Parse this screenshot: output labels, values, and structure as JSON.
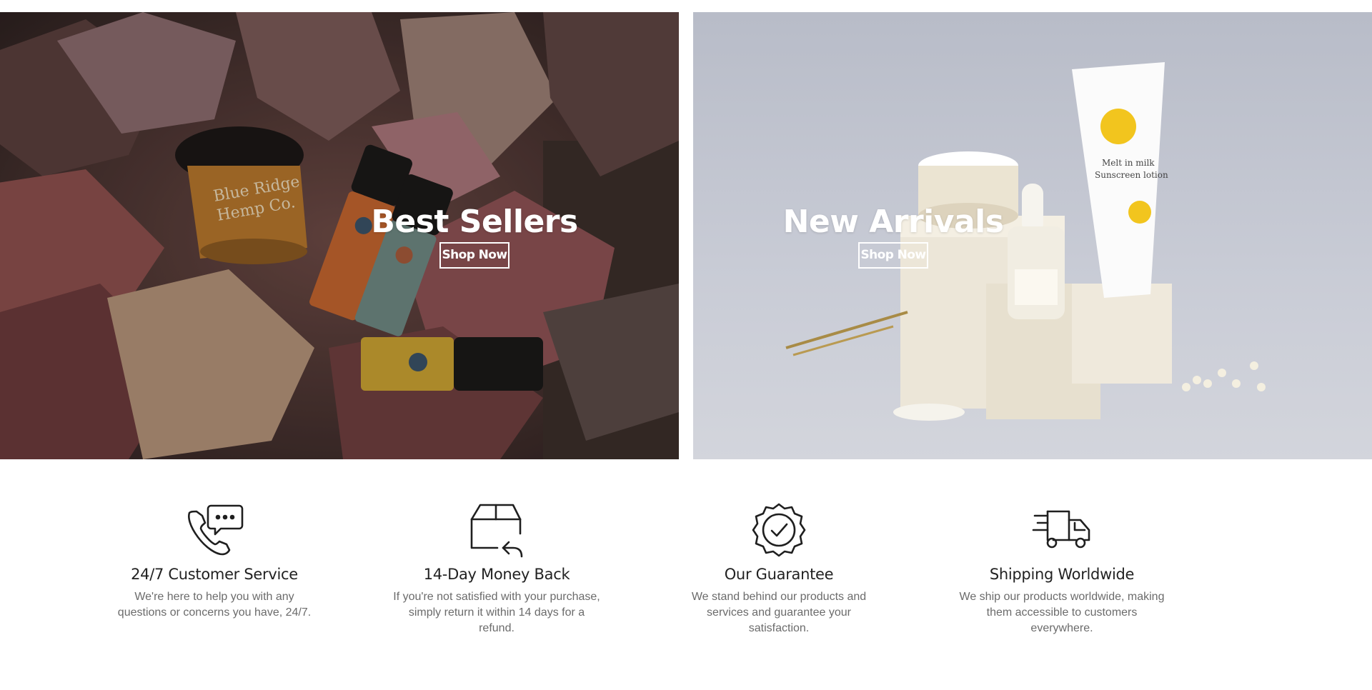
{
  "banners": [
    {
      "title": "Best Sellers",
      "button_label": "Shop Now",
      "image": "cbd-products-on-autumn-leaves-photo"
    },
    {
      "title": "New Arrivals",
      "button_label": "Shop Now",
      "image": "skincare-products-on-pedestals-photo"
    }
  ],
  "features": [
    {
      "icon": "phone-chat-icon",
      "title": "24/7 Customer Service",
      "text": "We're here to help you with any questions or concerns you have, 24/7."
    },
    {
      "icon": "box-return-icon",
      "title": "14-Day Money Back",
      "text": "If you're not satisfied with your purchase, simply return it within 14 days for a refund."
    },
    {
      "icon": "badge-check-icon",
      "title": "Our Guarantee",
      "text": "We stand behind our products and services and guarantee your satisfaction."
    },
    {
      "icon": "delivery-truck-icon",
      "title": "Shipping Worldwide",
      "text": "We ship our products worldwide, making them accessible to customers everywhere."
    }
  ],
  "colors": {
    "text_dark": "#222222",
    "text_muted": "#6b6b6b",
    "button_border": "#ffffff"
  }
}
